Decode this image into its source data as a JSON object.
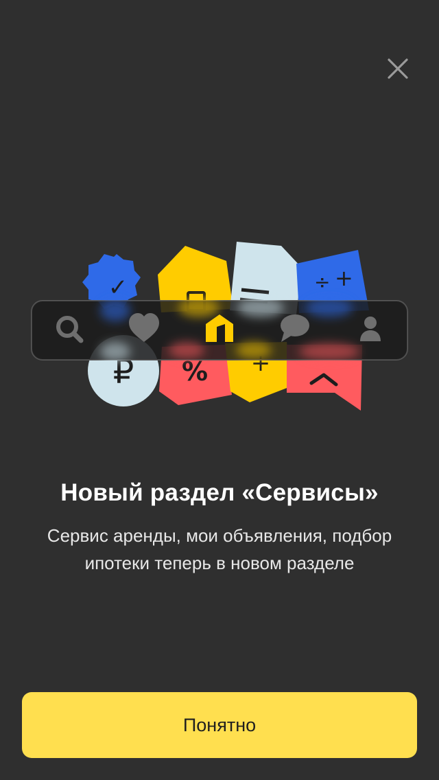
{
  "modal": {
    "title": "Новый раздел «Сервисы»",
    "description_line1": "Сервис аренды, мои объявления, подбор",
    "description_line2": "ипотеки теперь в новом разделе",
    "button_label": "Понятно"
  },
  "illustration": {
    "tab_icons": [
      "search-icon",
      "heart-icon",
      "home-icon",
      "chat-icon",
      "profile-icon"
    ],
    "active_tab": "home-icon",
    "badge_glyphs": {
      "check": "✓",
      "ruble": "₽",
      "percent": "%",
      "plus": "+",
      "equals": "=",
      "divide": "÷",
      "chevron": "^"
    }
  },
  "colors": {
    "background": "#2f2f2f",
    "accent_yellow": "#ffdf4f",
    "badge_blue": "#2f6ae8",
    "badge_yellow": "#ffcc00",
    "badge_light_blue": "#cfe4ec",
    "badge_red": "#ff5b5f"
  }
}
